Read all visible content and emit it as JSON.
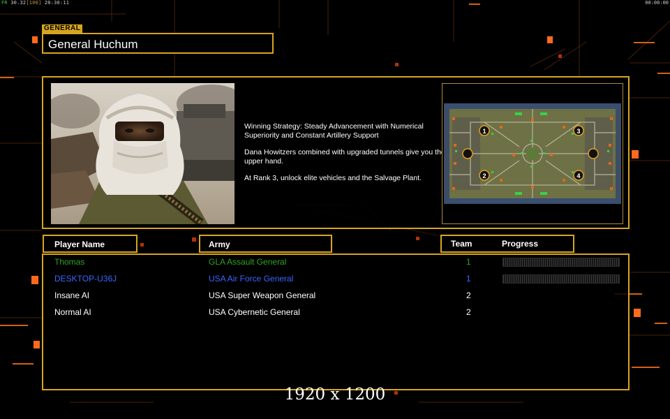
{
  "status_bar": {
    "fps": "FR",
    "values": "30.32",
    "limit": "[100]",
    "clock": "20:30:11",
    "timer": "00:00:00"
  },
  "general": {
    "section_label": "GENERAL",
    "name": "General Huchum"
  },
  "description": {
    "strategy": "Winning Strategy: Steady Advancement with Numerical Superiority and Constant Artillery Support",
    "tip": "Dana Howitzers combined with upgraded tunnels give you the upper hand.",
    "rank": "At Rank 3, unlock elite vehicles and the Salvage Plant."
  },
  "map": {
    "start_positions": [
      "1",
      "2",
      "3",
      "4"
    ]
  },
  "roster": {
    "headers": {
      "player_name": "Player Name",
      "army": "Army",
      "team": "Team",
      "progress": "Progress"
    },
    "players": [
      {
        "name": "Thomas",
        "army": "GLA Assault General",
        "team": "1",
        "color": "#2ea31f",
        "has_progress": true
      },
      {
        "name": "DESKTOP-U36J",
        "army": "USA Air Force General",
        "team": "1",
        "color": "#3a66ff",
        "has_progress": true
      },
      {
        "name": "Insane AI",
        "army": "USA Super Weapon General",
        "team": "2",
        "color": "#ffffff",
        "has_progress": false
      },
      {
        "name": "Normal AI",
        "army": "USA Cybernetic General",
        "team": "2",
        "color": "#ffffff",
        "has_progress": false
      }
    ]
  },
  "watermark": "1920 x 1200",
  "colors": {
    "accent": "#d8a521",
    "grid_orange": "#ff5a1a"
  }
}
